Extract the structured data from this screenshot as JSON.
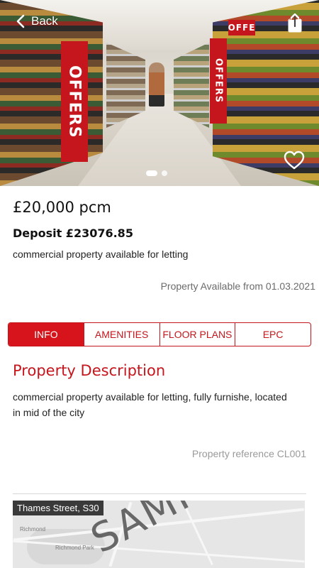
{
  "header": {
    "back_label": "Back",
    "hero_offer_text": "OFFERS",
    "hero_offer_text_small": "OFFERS",
    "hero_offer_sign": "OFFE",
    "carousel": {
      "count": 2,
      "active_index": 0
    }
  },
  "listing": {
    "price": "£20,000 pcm",
    "deposit": "Deposit £23076.85",
    "summary": "commercial property available for letting",
    "available_from": "Property Available from 01.03.2021"
  },
  "tabs": [
    {
      "label": "INFO",
      "active": true
    },
    {
      "label": "AMENITIES",
      "active": false
    },
    {
      "label": "FLOOR PLANS",
      "active": false
    },
    {
      "label": "EPC",
      "active": false
    }
  ],
  "description": {
    "title": "Property Description",
    "body": "commercial property available for letting, fully furnishe, located in mid of the city",
    "reference": "Property reference CL001"
  },
  "map": {
    "location_label": "Thames Street, S30",
    "watermark": "SAMPLE",
    "places": [
      "Richmond",
      "Richmond Park"
    ]
  },
  "colors": {
    "accent": "#c4161c",
    "tab_active_bg": "#d7141c",
    "muted_text": "#6b6b6b",
    "reference_text": "#9a9a9a"
  },
  "icons": {
    "back": "chevron-left-icon",
    "share": "share-icon",
    "favorite": "heart-icon"
  }
}
